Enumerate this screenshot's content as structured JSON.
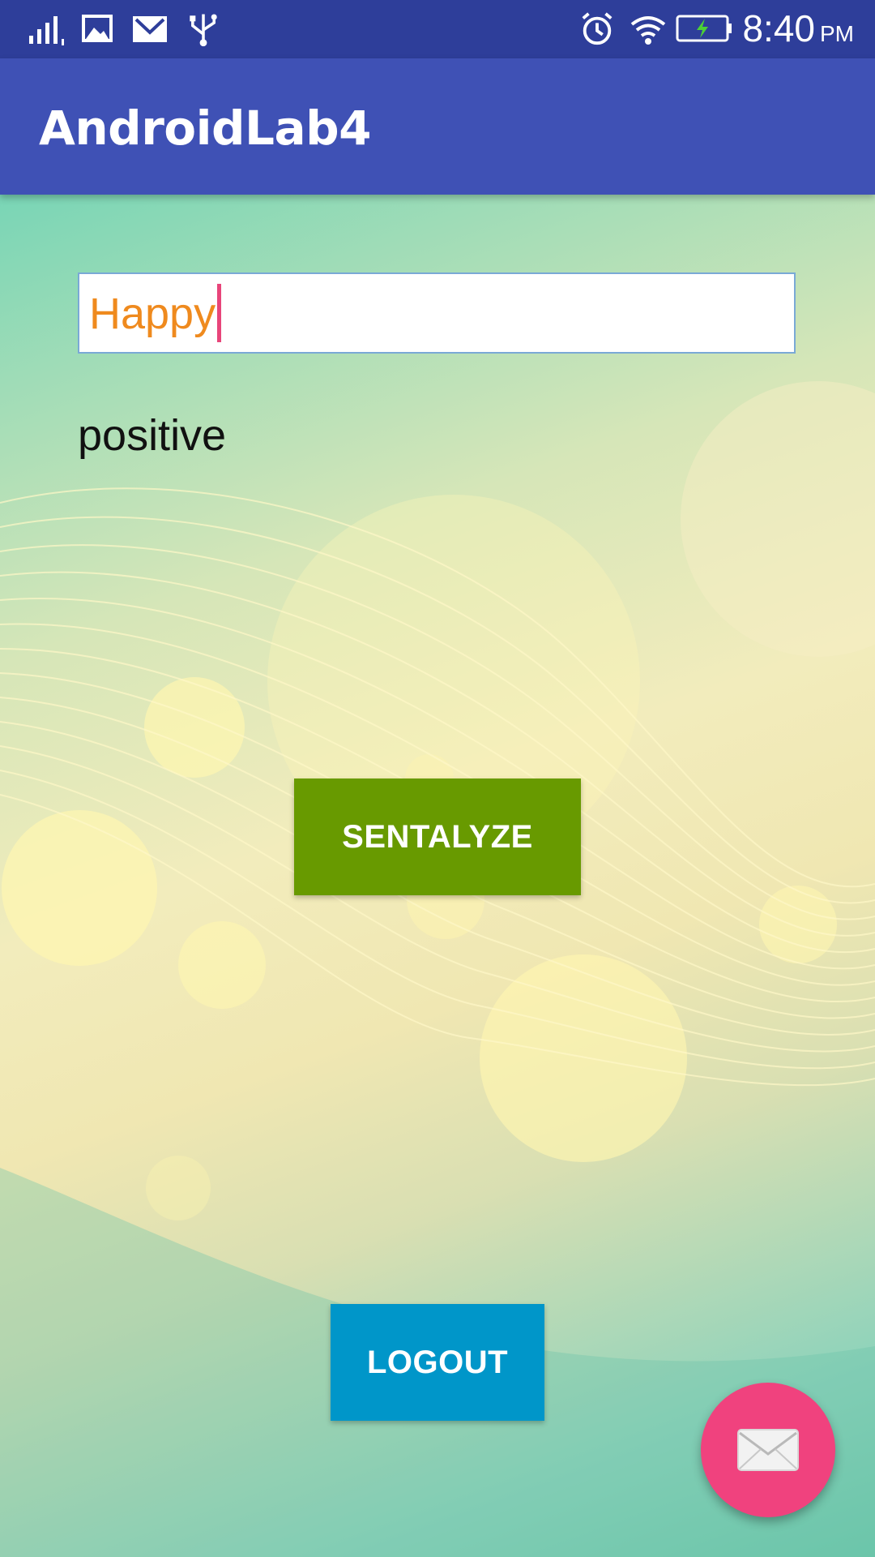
{
  "status_bar": {
    "time": "8:40",
    "ampm": "PM",
    "icons": [
      "signal-icon",
      "image-icon",
      "gmail-icon",
      "usb-icon",
      "alarm-icon",
      "wifi-icon",
      "battery-charging-icon"
    ]
  },
  "app_bar": {
    "title": "AndroidLab4"
  },
  "input": {
    "value": "Happy"
  },
  "result": {
    "text": "positive"
  },
  "buttons": {
    "sentalyze": "SENTALYZE",
    "logout": "LOGOUT"
  },
  "fab": {
    "icon": "email-icon"
  },
  "colors": {
    "status_bar": "#2e3e9a",
    "app_bar": "#3f51b5",
    "sentalyze": "#689a00",
    "logout": "#0096c9",
    "fab": "#f0427e",
    "input_text": "#ef8a1e",
    "cursor": "#e8457a"
  }
}
